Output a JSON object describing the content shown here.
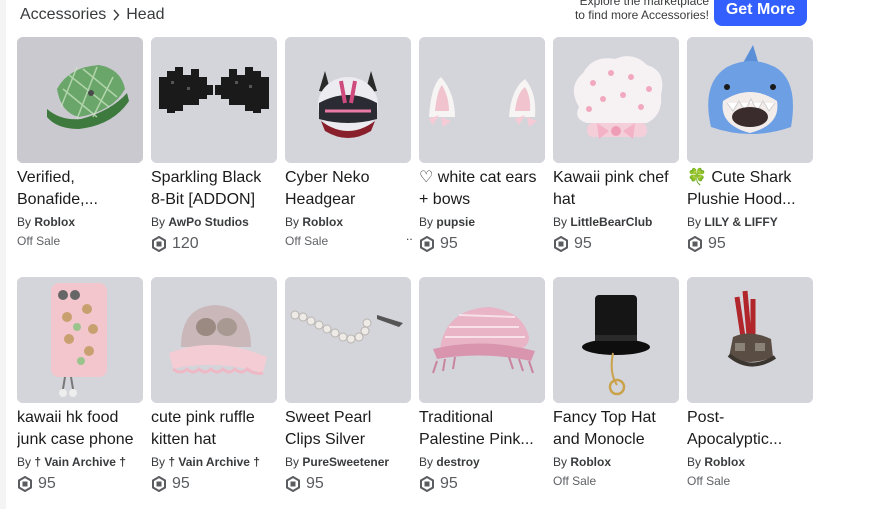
{
  "breadcrumb": {
    "parent": "Accessories",
    "current": "Head"
  },
  "promo": {
    "line1": "Explore the marketplace",
    "line2": "to find more Accessories!",
    "button": "Get More"
  },
  "items": [
    {
      "name": "Verified, Bonafide,...",
      "by": "By",
      "creator": "Roblox",
      "status": "Off Sale"
    },
    {
      "name": "Sparkling Black 8-Bit [ADDON]",
      "by": "By",
      "creator": "AwPo Studios",
      "price": "120"
    },
    {
      "name": "Cyber Neko Headgear",
      "by": "By",
      "creator": "Roblox",
      "status": "Off Sale"
    },
    {
      "name": "♡ white cat ears + bows",
      "by": "By",
      "creator": "pupsie",
      "price": "95"
    },
    {
      "name": "Kawaii pink chef hat",
      "by": "By",
      "creator": "LittleBearClub",
      "price": "95"
    },
    {
      "name": "🍀 Cute Shark Plushie Hood...",
      "by": "By",
      "creator": "LILY & LIFFY",
      "price": "95"
    },
    {
      "name": "kawaii hk food junk case phone",
      "by": "By",
      "creator": "† Vain Archive †",
      "price": "95"
    },
    {
      "name": "cute pink ruffle kitten hat",
      "by": "By",
      "creator": "† Vain Archive †",
      "price": "95"
    },
    {
      "name": "Sweet Pearl Clips Silver",
      "by": "By",
      "creator": "PureSweetener",
      "price": "95"
    },
    {
      "name": "Traditional Palestine Pink...",
      "by": "By",
      "creator": "destroy",
      "price": "95"
    },
    {
      "name": "Fancy Top Hat and Monocle",
      "by": "By",
      "creator": "Roblox",
      "status": "Off Sale"
    },
    {
      "name": "Post-Apocalyptic...",
      "by": "By",
      "creator": "Roblox",
      "status": "Off Sale"
    }
  ],
  "misc": {
    "dots": ".."
  },
  "colors": {
    "accent": "#335fff",
    "thumb_bg": "#d4d4db"
  }
}
